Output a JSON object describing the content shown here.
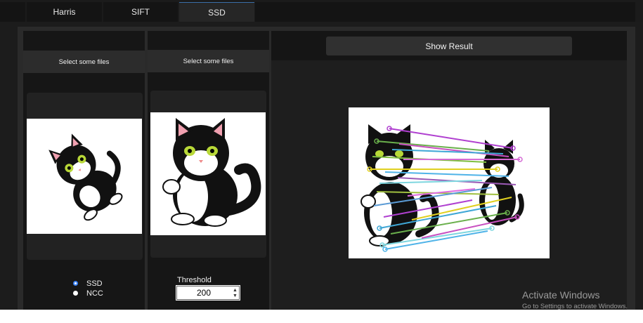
{
  "tabs": [
    {
      "label": "Harris"
    },
    {
      "label": "SIFT"
    },
    {
      "label": "SSD"
    }
  ],
  "input1": {
    "select_label": "Select some files"
  },
  "input2": {
    "select_label": "Select some files"
  },
  "result": {
    "show_label": "Show Result"
  },
  "methods": {
    "options": [
      "SSD",
      "NCC"
    ],
    "selected": "SSD"
  },
  "threshold": {
    "label": "Threshold",
    "value": "200"
  },
  "activation": {
    "title": "Activate Windows",
    "subtitle": "Go to Settings to activate Windows."
  },
  "colors": {
    "accent": "#3b82f6",
    "match_lines": [
      "#a040c8",
      "#6ab04c",
      "#c850c0",
      "#3fa7d6",
      "#7fbf3f",
      "#d46ad4",
      "#f0c419",
      "#4fb3e8",
      "#9b59b6",
      "#7ed6df"
    ]
  }
}
